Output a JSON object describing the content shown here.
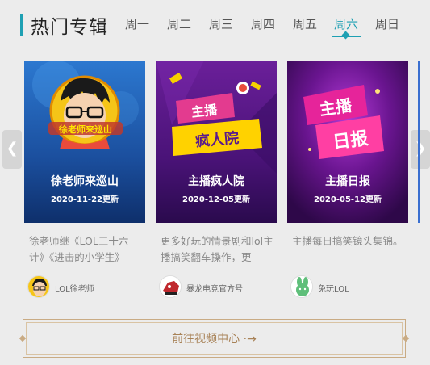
{
  "header": {
    "title": "热门专辑",
    "tabs": [
      {
        "label": "周一",
        "active": false
      },
      {
        "label": "周二",
        "active": false
      },
      {
        "label": "周三",
        "active": false
      },
      {
        "label": "周四",
        "active": false
      },
      {
        "label": "周五",
        "active": false
      },
      {
        "label": "周六",
        "active": true
      },
      {
        "label": "周日",
        "active": false
      }
    ],
    "accent_color": "#1ea0b3"
  },
  "carousel": {
    "prev_icon": "chevron-left-icon",
    "next_icon": "chevron-right-icon",
    "cards": [
      {
        "title": "徐老师来巡山",
        "updated": "2020-11-22更新",
        "description": "徐老师继《LOL三十六计》《进击的小学生》",
        "author": "LOL徐老师",
        "thumb_colors": [
          "#1f5db0",
          "#0d3a80"
        ],
        "logo_text": "徐老师来巡山"
      },
      {
        "title": "主播疯人院",
        "updated": "2020-12-05更新",
        "description": "更多好玩的情景剧和lol主播搞笑翻车操作，更",
        "author": "暴龙电竞官方号",
        "thumb_colors": [
          "#5a1a8c",
          "#2e0b55"
        ],
        "logo_text": "主播疯人院"
      },
      {
        "title": "主播日报",
        "updated": "2020-05-12更新",
        "description": "主播每日搞笑镜头集锦。",
        "author": "兔玩LOL",
        "thumb_colors": [
          "#6a1590",
          "#3a0a5a"
        ],
        "logo_text": "主播日报"
      }
    ]
  },
  "footer": {
    "more_label": "前往视频中心 ·→",
    "border_color": "#c9ab84"
  }
}
